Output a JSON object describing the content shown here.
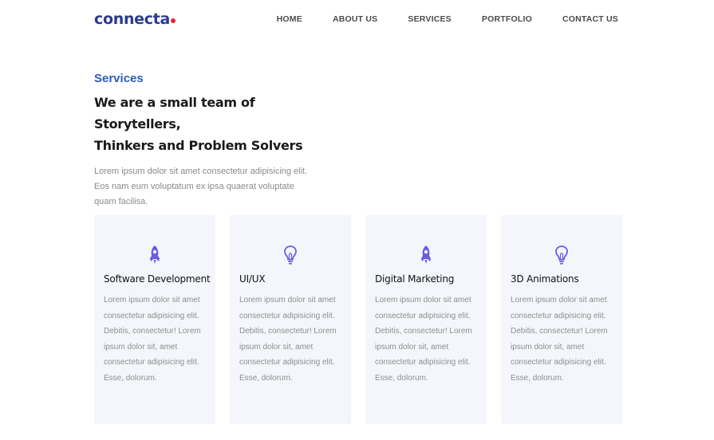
{
  "brand": {
    "name": "connecta",
    "accent": "#2a3a8c",
    "dot_color": "#e8262c"
  },
  "nav": {
    "items": [
      {
        "label": "HOME"
      },
      {
        "label": "ABOUT US"
      },
      {
        "label": "SERVICES"
      },
      {
        "label": "PORTFOLIO"
      },
      {
        "label": "CONTACT US"
      }
    ]
  },
  "intro": {
    "eyebrow": "Services",
    "headline_line1": "We are a small team of Storytellers,",
    "headline_line2": "Thinkers and Problem Solvers",
    "lead": "Lorem ipsum dolor sit amet consectetur adipisicing elit. Eos nam eum voluptatum ex ipsa quaerat voluptate quam facilisa."
  },
  "cards": [
    {
      "icon": "rocket-icon",
      "title": "Software Development",
      "desc": "Lorem ipsum dolor sit amet consectetur adipisicing elit. Debitis, consectetur! Lorem ipsum dolor sit, amet consectetur adipisicing elit. Esse, dolorum."
    },
    {
      "icon": "lightbulb-icon",
      "title": "UI/UX",
      "desc": "Lorem ipsum dolor sit amet consectetur adipisicing elit. Debitis, consectetur! Lorem ipsum dolor sit, amet consectetur adipisicing elit. Esse, dolorum."
    },
    {
      "icon": "rocket-icon",
      "title": "Digital Marketing",
      "desc": "Lorem ipsum dolor sit amet consectetur adipisicing elit. Debitis, consectetur! Lorem ipsum dolor sit, amet consectetur adipisicing elit. Esse, dolorum."
    },
    {
      "icon": "lightbulb-icon",
      "title": "3D Animations",
      "desc": "Lorem ipsum dolor sit amet consectetur adipisicing elit. Debitis, consectetur! Lorem ipsum dolor sit, amet consectetur adipisicing elit. Esse, dolorum."
    }
  ],
  "colors": {
    "icon": "#6c5ce7",
    "card_bg": "#f4f6fb",
    "eyebrow": "#2d5cb8"
  }
}
